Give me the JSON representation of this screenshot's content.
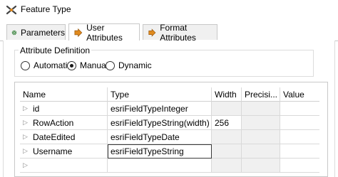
{
  "window": {
    "title": "Feature Type"
  },
  "tabs": [
    {
      "label": "Parameters",
      "icon": "gear-icon"
    },
    {
      "label": "User Attributes",
      "icon": "arrow-right-icon",
      "active": true
    },
    {
      "label": "Format Attributes",
      "icon": "arrow-right-icon"
    }
  ],
  "attribute_definition": {
    "label": "Attribute Definition",
    "options": [
      "Automatic",
      "Manual",
      "Dynamic"
    ],
    "selected": "Manual"
  },
  "table": {
    "columns": [
      "Name",
      "Type",
      "Width",
      "Precisi...",
      "Value"
    ],
    "rows": [
      {
        "name": "id",
        "type": "esriFieldTypeInteger",
        "width": "",
        "precision": "",
        "value": ""
      },
      {
        "name": "RowAction",
        "type": "esriFieldTypeString(width)",
        "width": "256",
        "precision": "",
        "value": ""
      },
      {
        "name": "DateEdited",
        "type": "esriFieldTypeDate",
        "width": "",
        "precision": "",
        "value": ""
      },
      {
        "name": "Username",
        "type": "esriFieldTypeString",
        "width": "",
        "precision": "",
        "value": ""
      },
      {
        "name": "",
        "type": "",
        "width": "",
        "precision": "",
        "value": ""
      }
    ]
  },
  "colors": {
    "accent": "#e08a1e",
    "gear": "#2e7d32",
    "cell_gray": "#f0f0f0"
  }
}
